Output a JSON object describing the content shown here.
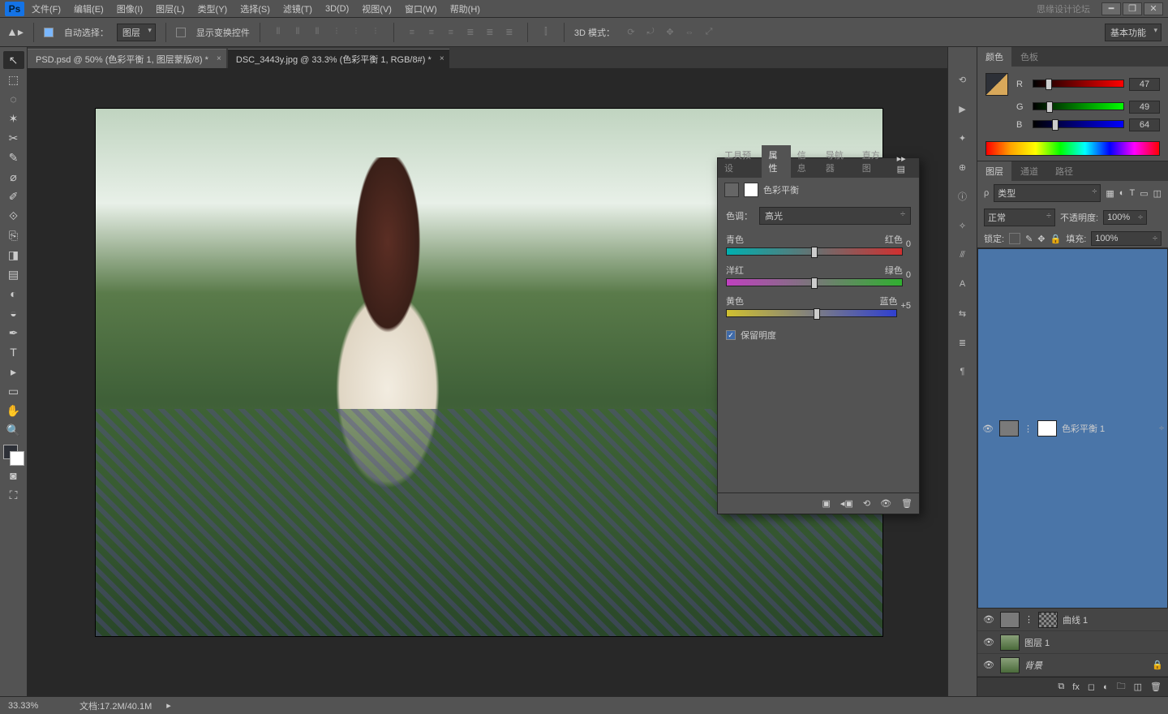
{
  "menubar": {
    "items": [
      "文件(F)",
      "编辑(E)",
      "图像(I)",
      "图层(L)",
      "类型(Y)",
      "选择(S)",
      "滤镜(T)",
      "3D(D)",
      "视图(V)",
      "窗口(W)",
      "帮助(H)"
    ],
    "brand": "思缘设计论坛"
  },
  "optbar": {
    "autoSelectLabel": "自动选择：",
    "autoSelectValue": "图层",
    "showTransformLabel": "显示变换控件",
    "mode3dLabel": "3D 模式：",
    "workspace": "基本功能"
  },
  "doctabs": [
    "PSD.psd @ 50% (色彩平衡 1, 图层蒙版/8) *",
    "DSC_3443y.jpg @ 33.3% (色彩平衡 1, RGB/8#) *"
  ],
  "color_panel": {
    "tabs": [
      "颜色",
      "色板"
    ],
    "r": {
      "label": "R",
      "value": "47",
      "pct": 18
    },
    "g": {
      "label": "G",
      "value": "49",
      "pct": 19
    },
    "b": {
      "label": "B",
      "value": "64",
      "pct": 25
    }
  },
  "layers_panel": {
    "tabs": [
      "图层",
      "通道",
      "路径"
    ],
    "kind": "类型",
    "blend": "正常",
    "opacityLabel": "不透明度:",
    "opacityValue": "100%",
    "lockLabel": "锁定:",
    "fillLabel": "填充:",
    "fillValue": "100%",
    "layers": [
      {
        "name": "色彩平衡 1",
        "selected": true,
        "adj": true,
        "eye": true,
        "mask": true
      },
      {
        "name": "曲线 1",
        "selected": false,
        "adj": true,
        "eye": true,
        "mask": true
      },
      {
        "name": "图层 1",
        "selected": false,
        "adj": false,
        "eye": true,
        "mask": false
      },
      {
        "name": "背景",
        "selected": false,
        "adj": false,
        "eye": true,
        "mask": false,
        "locked": true
      }
    ]
  },
  "properties_panel": {
    "tabs": [
      "工具预设",
      "属性",
      "信息",
      "导航器",
      "直方图"
    ],
    "activeTab": 1,
    "title": "色彩平衡",
    "toneLabel": "色调：",
    "toneValue": "高光",
    "sliders": [
      {
        "left": "青色",
        "right": "红色",
        "value": "0",
        "pos": 50,
        "gradient": "linear-gradient(90deg,#00b0b0,#d03030)"
      },
      {
        "left": "洋红",
        "right": "绿色",
        "value": "0",
        "pos": 50,
        "gradient": "linear-gradient(90deg,#c040c0,#30b030)"
      },
      {
        "left": "黄色",
        "right": "蓝色",
        "value": "+5",
        "pos": 53,
        "gradient": "linear-gradient(90deg,#d0c030,#3040d0)"
      }
    ],
    "preserveLabel": "保留明度"
  },
  "statusbar": {
    "zoom": "33.33%",
    "docinfoLabel": "文档:",
    "docsize": "17.2M/40.1M"
  },
  "tools_list": [
    "▲",
    "⬚",
    "◌",
    "✶",
    "⬚",
    "✎",
    "⌀",
    "✚",
    "⟐",
    "⎘",
    "↯",
    "⌑",
    "◐",
    "◧",
    "◒",
    "⚙",
    "⟲",
    "T",
    "▸",
    "⬜",
    "✋",
    "🔍"
  ]
}
